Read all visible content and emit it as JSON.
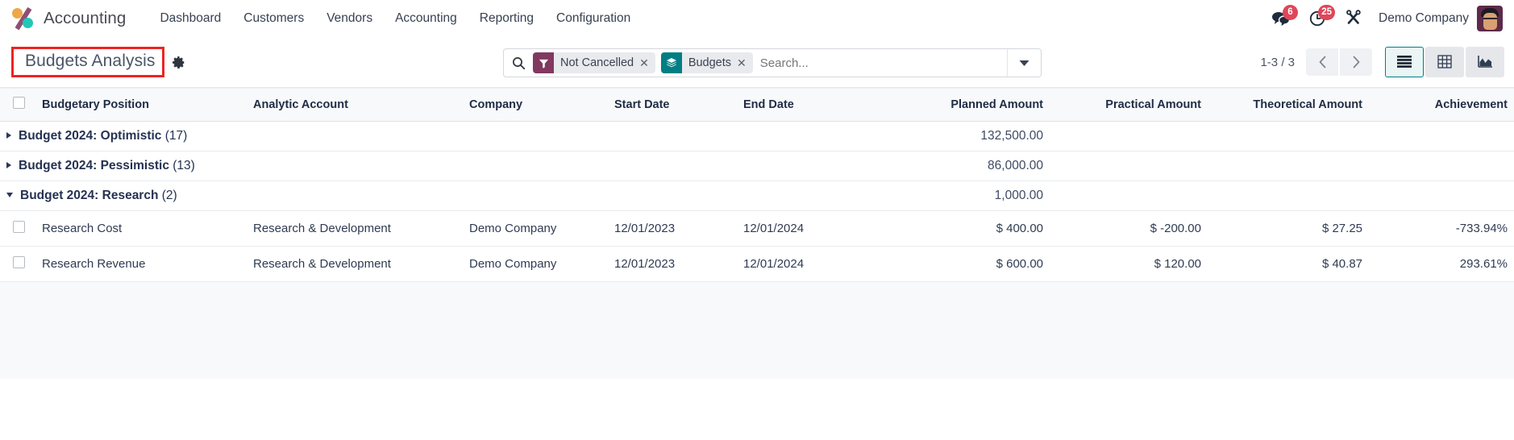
{
  "navbar": {
    "brand": "Accounting",
    "logo_icon": "odoo-percent-logo",
    "menu": [
      {
        "label": "Dashboard"
      },
      {
        "label": "Customers"
      },
      {
        "label": "Vendors"
      },
      {
        "label": "Accounting"
      },
      {
        "label": "Reporting"
      },
      {
        "label": "Configuration"
      }
    ],
    "messages": {
      "icon": "chat-bubbles-icon",
      "count": "6"
    },
    "activities": {
      "icon": "clock-icon",
      "count": "25"
    },
    "debug": {
      "icon": "wrench-tools-icon"
    },
    "company": "Demo Company",
    "avatar_icon": "user-avatar"
  },
  "control_panel": {
    "title": "Budgets Analysis",
    "settings_icon": "gear-icon",
    "highlight_color": "#ee2322",
    "search": {
      "icon": "search-icon",
      "placeholder": "Search...",
      "value": "",
      "dropdown_icon": "chevron-down-icon",
      "facets": [
        {
          "icon": "filter-funnel-icon",
          "label": "Not Cancelled",
          "color": "#81395f",
          "remove_icon": "close-icon"
        },
        {
          "icon": "layers-group-icon",
          "label": "Budgets",
          "color": "#017e84",
          "remove_icon": "close-icon"
        }
      ]
    },
    "pager": {
      "count": "1-3 / 3",
      "prev_icon": "chevron-left-icon",
      "next_icon": "chevron-right-icon"
    },
    "views": [
      {
        "name": "list",
        "icon": "list-view-icon",
        "active": true
      },
      {
        "name": "pivot",
        "icon": "pivot-table-icon",
        "active": false
      },
      {
        "name": "graph",
        "icon": "area-chart-icon",
        "active": false
      }
    ]
  },
  "table": {
    "select_all_icon": "checkbox-icon",
    "columns": [
      "Budgetary Position",
      "Analytic Account",
      "Company",
      "Start Date",
      "End Date",
      "Planned Amount",
      "Practical Amount",
      "Theoretical Amount",
      "Achievement"
    ],
    "groups": [
      {
        "label": "Budget 2024: Optimistic",
        "count": "(17)",
        "expanded": false,
        "planned_amount": "132,500.00",
        "practical_amount": "",
        "theoretical_amount": "",
        "achievement": "",
        "rows": []
      },
      {
        "label": "Budget 2024: Pessimistic",
        "count": "(13)",
        "expanded": false,
        "planned_amount": "86,000.00",
        "practical_amount": "",
        "theoretical_amount": "",
        "achievement": "",
        "rows": []
      },
      {
        "label": "Budget 2024: Research",
        "count": "(2)",
        "expanded": true,
        "planned_amount": "1,000.00",
        "practical_amount": "",
        "theoretical_amount": "",
        "achievement": "",
        "rows": [
          {
            "budgetary_position": "Research Cost",
            "analytic_account": "Research & Development",
            "company": "Demo Company",
            "start_date": "12/01/2023",
            "end_date": "12/01/2024",
            "planned_amount": "$ 400.00",
            "practical_amount": "$ -200.00",
            "theoretical_amount": "$ 27.25",
            "achievement": "-733.94%"
          },
          {
            "budgetary_position": "Research Revenue",
            "analytic_account": "Research & Development",
            "company": "Demo Company",
            "start_date": "12/01/2023",
            "end_date": "12/01/2024",
            "planned_amount": "$ 600.00",
            "practical_amount": "$ 120.00",
            "theoretical_amount": "$ 40.87",
            "achievement": "293.61%"
          }
        ]
      }
    ]
  }
}
